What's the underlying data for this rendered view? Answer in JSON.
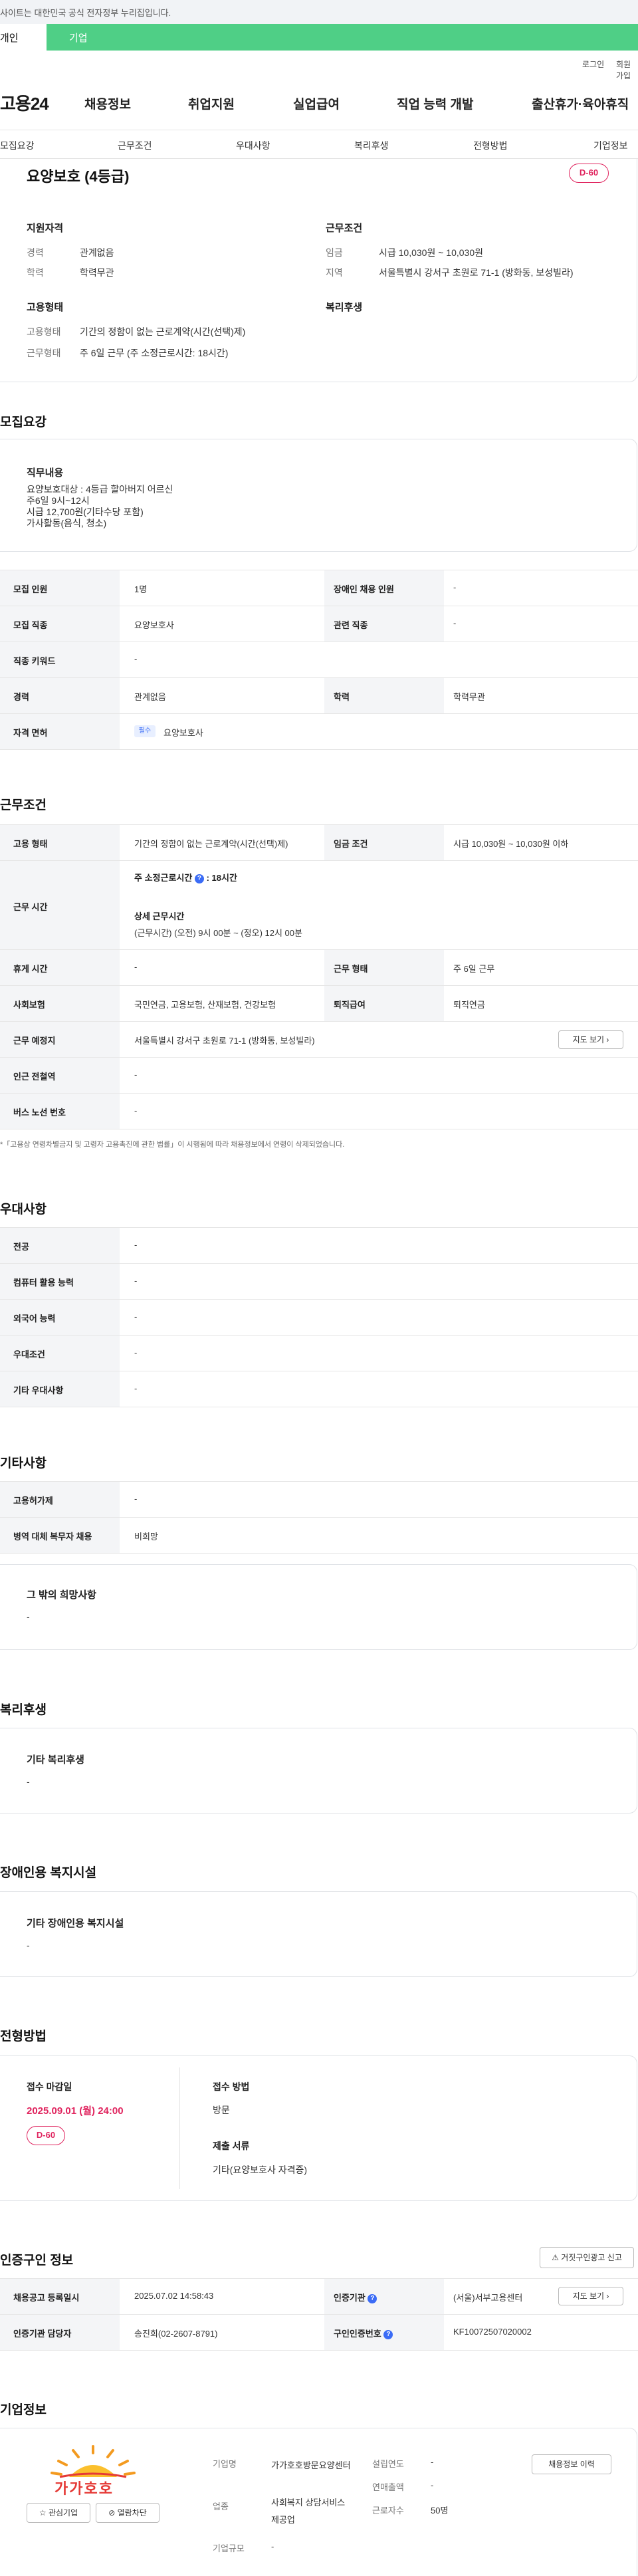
{
  "topbar": {
    "notice": "사이트는 대한민국 공식 전자정부 누리집입니다."
  },
  "tabs": {
    "person": "개인",
    "corp": "기업"
  },
  "util": {
    "login": "로그인",
    "join": "회원가입"
  },
  "header": {
    "logo": "고용24",
    "gnb": [
      "채용정보",
      "취업지원",
      "실업급여",
      "직업 능력 개발",
      "출산휴가·육아휴직"
    ]
  },
  "subnav": [
    "모집요강",
    "근무조건",
    "우대사항",
    "복리후생",
    "전형방법",
    "기업정보"
  ],
  "summary": {
    "title": "요양보호 (4등급)",
    "dday": "D-60",
    "qual_title": "지원자격",
    "career_label": "경력",
    "career_value": "관계없음",
    "edu_label": "학력",
    "edu_value": "학력무관",
    "cond_title": "근무조건",
    "wage_label": "임금",
    "wage_value": "시급 10,030원 ~ 10,030원",
    "loc_label": "지역",
    "loc_value": "서울특별시 강서구 초원로 71-1 (방화동, 보성빌라)",
    "emp_title": "고용형태",
    "emp_label": "고용형태",
    "emp_value": "기간의 정함이 없는 근로계약(시간(선택)제)",
    "work_label": "근무형태",
    "work_value": "주 6일 근무 (주 소정근로시간: 18시간)",
    "welfare_title": "복리후생"
  },
  "recruit": {
    "title": "모집요강",
    "duty_title": "직무내용",
    "duty_text": "요양보호대상 : 4등급 할아버지 어르신\n주6일 9시~12시\n시급 12,700원(기타수당 포함)\n가사활동(음식, 청소)",
    "rows": {
      "r1": {
        "l1": "모집 인원",
        "v1": "1명",
        "l2": "장애인 채용 인원",
        "v2": "-"
      },
      "r2": {
        "l1": "모집 직종",
        "v1": "요양보호사",
        "l2": "관련 직종",
        "v2": "-"
      },
      "r3": {
        "l1": "직종 키워드",
        "v1": "-"
      },
      "r4": {
        "l1": "경력",
        "v1": "관계없음",
        "l2": "학력",
        "v2": "학력무관"
      },
      "r5": {
        "l1": "자격 면허",
        "chip": "필수",
        "v1": "요양보호사"
      }
    }
  },
  "work": {
    "title": "근무조건",
    "emp_label": "고용 형태",
    "emp_value": "기간의 정함이 없는 근로계약(시간(선택)제)",
    "wage_label": "임금 조건",
    "wage_value": "시급 10,030원 ~ 10,030원 이하",
    "time_label": "근무 시간",
    "weekly_label": "주 소정근로시간",
    "weekly_value": ": 18시간",
    "detail_label": "상세 근무시간",
    "detail_value": "(근무시간) (오전) 9시 00분 ~ (정오) 12시 00분",
    "rest_label": "휴게 시간",
    "rest_value": "-",
    "form_label": "근무 형태",
    "form_value": "주 6일 근무",
    "ins_label": "사회보험",
    "ins_value": "국민연금, 고용보험, 산재보험, 건강보험",
    "sev_label": "퇴직급여",
    "sev_value": "퇴직연금",
    "place_label": "근무 예정지",
    "place_value": "서울특별시 강서구 초원로 71-1 (방화동, 보성빌라)",
    "map_btn": "지도 보기",
    "subway_label": "인근 전철역",
    "subway_value": "-",
    "bus_label": "버스 노선 번호",
    "bus_value": "-",
    "note": "*「고용상 연령차별금지 및 고령자 고용촉진에 관한 법률」이 시행됨에 따라 채용정보에서 연령이 삭제되었습니다."
  },
  "pref": {
    "title": "우대사항",
    "rows": [
      {
        "label": "전공",
        "value": "-"
      },
      {
        "label": "컴퓨터 활용 능력",
        "value": "-"
      },
      {
        "label": "외국어 능력",
        "value": "-"
      },
      {
        "label": "우대조건",
        "value": "-"
      },
      {
        "label": "기타 우대사항",
        "value": "-"
      }
    ]
  },
  "etc": {
    "title": "기타사항",
    "rows": [
      {
        "label": "고용허가제",
        "value": "-"
      },
      {
        "label": "병역 대체 복무자 채용",
        "value": "비희망"
      }
    ],
    "hope_title": "그 밖의 희망사항",
    "hope_value": "-"
  },
  "welfare": {
    "title": "복리후생",
    "box_title": "기타 복리후생",
    "box_value": "-"
  },
  "disabled": {
    "title": "장애인용 복지시설",
    "box_title": "기타 장애인용 복지시설",
    "box_value": "-"
  },
  "selection": {
    "title": "전형방법",
    "deadline_label": "접수 마감일",
    "deadline_value": "2025.09.01 (월) 24:00",
    "dday": "D-60",
    "method_label": "접수 방법",
    "method_value": "방문",
    "docs_label": "제출 서류",
    "docs_value": "기타(요양보호사 자격증)"
  },
  "cert": {
    "title": "인증구인 정보",
    "report_btn": "거짓구인광고 신고",
    "reg_label": "채용공고 등록일시",
    "reg_value": "2025.07.02 14:58:43",
    "org_label": "인증기관",
    "org_value": "(서울)서부고용센터",
    "map_btn": "지도 보기",
    "mgr_label": "인증기관 담당자",
    "mgr_value": "송진희(02-2607-8791)",
    "no_label": "구인인증번호",
    "no_value": "KF10072507020002"
  },
  "company": {
    "title": "기업정보",
    "logo_text": "가가호호",
    "fav_btn": "관심기업",
    "block_btn": "열람차단",
    "name_label": "기업명",
    "name_value": "가가호호방문요양센터",
    "ind_label": "업종",
    "ind_value": "사회복지 상담서비스 제공업",
    "size_label": "기업규모",
    "size_value": "-",
    "year_label": "설립연도",
    "year_value": "-",
    "sales_label": "연매출액",
    "sales_value": "-",
    "emp_label": "근로자수",
    "emp_value": "50명",
    "history_btn": "채용정보 이력"
  },
  "colors": {
    "accent": "#4fcf86",
    "dday": "#e0245e",
    "link": "#3b6cf6"
  }
}
